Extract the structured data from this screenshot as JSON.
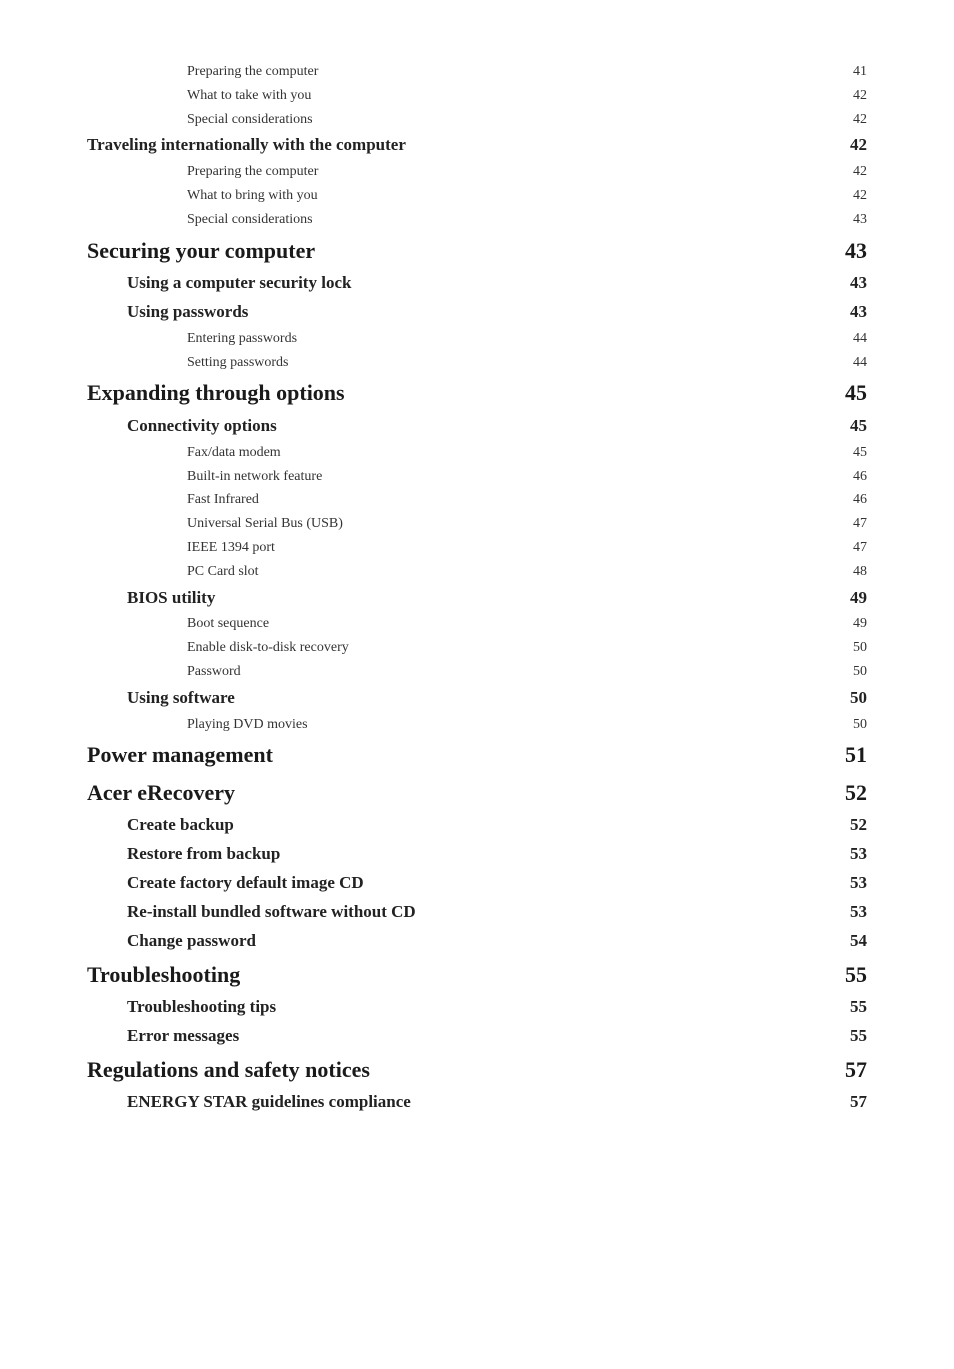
{
  "toc": {
    "entries": [
      {
        "level": 3,
        "title": "Preparing the computer",
        "page": "41"
      },
      {
        "level": 3,
        "title": "What to take with you",
        "page": "42"
      },
      {
        "level": 3,
        "title": "Special considerations",
        "page": "42"
      },
      {
        "level": 2,
        "title": "Traveling internationally with the computer",
        "page": "42",
        "inline": true
      },
      {
        "level": 3,
        "title": "Preparing the computer",
        "page": "42"
      },
      {
        "level": 3,
        "title": "What to bring with you",
        "page": "42"
      },
      {
        "level": 3,
        "title": "Special considerations",
        "page": "43"
      },
      {
        "level": 1,
        "title": "Securing your computer",
        "page": "43"
      },
      {
        "level": 2,
        "title": "Using a computer security lock",
        "page": "43"
      },
      {
        "level": 2,
        "title": "Using passwords",
        "page": "43"
      },
      {
        "level": 3,
        "title": "Entering passwords",
        "page": "44"
      },
      {
        "level": 3,
        "title": "Setting passwords",
        "page": "44"
      },
      {
        "level": 1,
        "title": "Expanding through options",
        "page": "45"
      },
      {
        "level": 2,
        "title": "Connectivity options",
        "page": "45"
      },
      {
        "level": 3,
        "title": "Fax/data modem",
        "page": "45"
      },
      {
        "level": 3,
        "title": "Built-in network feature",
        "page": "46"
      },
      {
        "level": 3,
        "title": "Fast Infrared",
        "page": "46"
      },
      {
        "level": 3,
        "title": "Universal Serial Bus (USB)",
        "page": "47"
      },
      {
        "level": 3,
        "title": "IEEE 1394 port",
        "page": "47"
      },
      {
        "level": 3,
        "title": "PC Card slot",
        "page": "48"
      },
      {
        "level": 2,
        "title": "BIOS utility",
        "page": "49"
      },
      {
        "level": 3,
        "title": "Boot sequence",
        "page": "49"
      },
      {
        "level": 3,
        "title": "Enable disk-to-disk recovery",
        "page": "50"
      },
      {
        "level": 3,
        "title": "Password",
        "page": "50"
      },
      {
        "level": 2,
        "title": "Using software",
        "page": "50"
      },
      {
        "level": 3,
        "title": "Playing DVD movies",
        "page": "50"
      },
      {
        "level": 1,
        "title": "Power management",
        "page": "51"
      },
      {
        "level": 1,
        "title": "Acer eRecovery",
        "page": "52"
      },
      {
        "level": 2,
        "title": "Create backup",
        "page": "52"
      },
      {
        "level": 2,
        "title": "Restore from backup",
        "page": "53"
      },
      {
        "level": 2,
        "title": "Create factory default image CD",
        "page": "53"
      },
      {
        "level": 2,
        "title": "Re-install bundled software without CD",
        "page": "53"
      },
      {
        "level": 2,
        "title": "Change password",
        "page": "54"
      },
      {
        "level": 1,
        "title": "Troubleshooting",
        "page": "55"
      },
      {
        "level": 2,
        "title": "Troubleshooting tips",
        "page": "55"
      },
      {
        "level": 2,
        "title": "Error messages",
        "page": "55"
      },
      {
        "level": 1,
        "title": "Regulations and safety notices",
        "page": "57"
      },
      {
        "level": 2,
        "title": "ENERGY STAR guidelines compliance",
        "page": "57"
      }
    ]
  }
}
